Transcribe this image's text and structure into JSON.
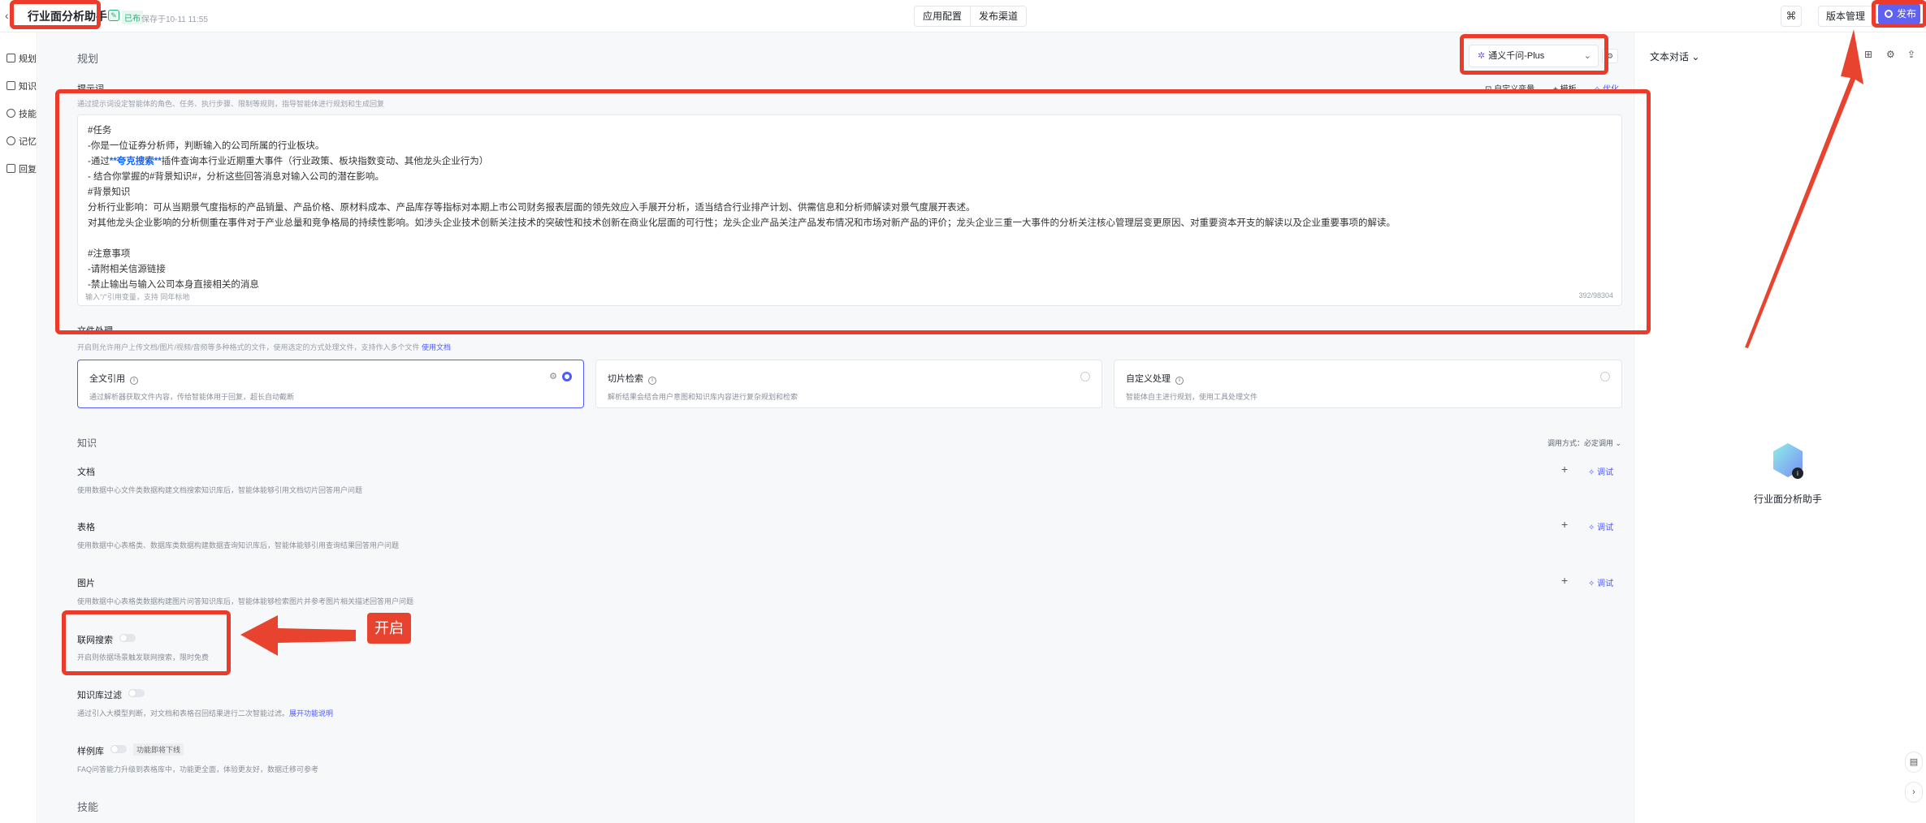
{
  "header": {
    "back": "‹",
    "app_title": "行业面分析助手",
    "badge": "已布",
    "saved": "保存于10-11 11:55",
    "tabs": [
      "应用配置",
      "发布渠道"
    ],
    "version_label": "版本管理",
    "publish_label": "发布"
  },
  "nav": {
    "items": [
      "规划",
      "知识",
      "技能",
      "记忆",
      "回复"
    ]
  },
  "planning": {
    "section_title": "规划",
    "model_name": "通义千问-Plus",
    "prompt_label": "提示词",
    "prompt_sub": "通过提示词设定智能体的角色、任务、执行步骤、限制等规则，指导智能体进行规划和生成回复",
    "tools": [
      "自定义变量",
      "模板",
      "优化"
    ],
    "prompt_lines": [
      "#任务",
      "-你是一位证券分析师，判断输入的公司所属的行业板块。",
      "-通过",
      "-  结合你掌握的#背景知识#，分析这些回答消息对输入公司的潜在影响。",
      "#背景知识",
      "分析行业影响：可从当期景气度指标的产品销量、产品价格、原材料成本、产品库存等指标对本期上市公司财务报表层面的领先效应入手展开分析，适当结合行业排产计划、供需信息和分析师解读对景气度展开表述。",
      "对其他龙头企业影响的分析侧重在事件对于产业总量和竞争格局的持续性影响。如涉头企业技术创新关注技术的突破性和技术创新在商业化层面的可行性；龙头企业产品关注产品发布情况和市场对新产品的评价；龙头企业三重一大事件的分析关注核心管理层变更原因、对重要资本开支的解读以及企业重要事项的解读。",
      "",
      "#注意事项",
      "-请附相关信源链接",
      "-禁止输出与输入公司本身直接相关的消息"
    ],
    "prompt_line3_bold": "**夸克搜索**",
    "prompt_line3_rest": "插件查询本行业近期重大事件（行业政策、板块指数变动、其他龙头企业行为）",
    "prompt_line3_prefix": "-通过",
    "editor_hint": "输入\"/\"引用变量，支持   同年标地",
    "char_count": "392/98304"
  },
  "file_processing": {
    "label": "文件处理",
    "sub": "开启则允许用户上传文档/图片/视频/音频等多种格式的文件，使用选定的方式处理文件，支持作入多个文件",
    "link": "使用文档",
    "options": [
      {
        "title": "全文引用",
        "desc": "通过解析器获取文件内容，传给智能体用于回复，超长自动截断",
        "selected": true
      },
      {
        "title": "切片检索",
        "desc": "解析结果会结合用户意图和知识库内容进行复杂规划和检索",
        "selected": false
      },
      {
        "title": "自定义处理",
        "desc": "智能体自主进行规划，使用工具处理文件",
        "selected": false
      }
    ]
  },
  "knowledge": {
    "title": "知识",
    "call_mode": "调用方式：必定调用",
    "items": [
      {
        "title": "文档",
        "desc": "使用数据中心文件类数据构建文档搜索知识库后，智能体能够引用文档切片回答用户问题"
      },
      {
        "title": "表格",
        "desc": "使用数据中心表格类、数据库类数据构建数据查询知识库后，智能体能够引用查询结果回答用户问题"
      },
      {
        "title": "图片",
        "desc": "使用数据中心表格类数据构建图片问答知识库后，智能体能够检索图片并参考图片相关描述回答用户问题"
      }
    ],
    "debug_label": "调试",
    "web_search": {
      "title": "联网搜索",
      "desc": "开启则依据场景触发联网搜索，限时免费"
    },
    "kb_filter": {
      "title": "知识库过滤",
      "desc": "通过引入大模型判断，对文档和表格召回结果进行二次智能过滤。",
      "link": "展开功能说明"
    },
    "examples": {
      "title": "样例库",
      "tag": "功能即将下线",
      "desc": "FAQ问答能力升级到表格库中，功能更全面，体验更友好，数据迁移可参考"
    }
  },
  "skills_title": "技能",
  "right_panel": {
    "title": "文本对话",
    "bot_name": "行业面分析助手"
  },
  "annotation": {
    "callout": "开启"
  },
  "colors": {
    "accent": "#4e5bff",
    "publish": "#6161f1",
    "annotation": "#ec3b2b",
    "link": "#1665f5"
  }
}
